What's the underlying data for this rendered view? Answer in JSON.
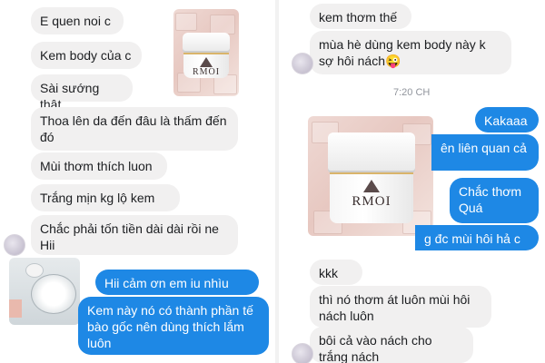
{
  "left_chat": {
    "incoming": [
      "E quen noi c",
      "Kem body của c",
      "Sài sướng thật",
      "Thoa lên da đến đâu là thấm đến đó",
      "Mùi thơm thích luon",
      "Trắng mịn kg lộ kem",
      "Chắc phải tốn tiền dài dài rồi ne Hii"
    ],
    "outgoing": [
      "Hii cảm ơn em iu nhìu nhé",
      "Kem này nó có thành phần tế bào gốc nên dùng thích lắm luôn"
    ],
    "photo_brand": "RMOI"
  },
  "right_chat": {
    "incoming_top": [
      "kem thơm thế",
      "mùa hè dùng kem body này k sợ hôi nách😜"
    ],
    "timestamp": "7:20 CH",
    "outgoing": [
      "Kakaaa",
      "ên liên quan cả",
      "Chắc thơm Quá",
      "g đc mùi hôi hả c"
    ],
    "incoming_bottom": [
      "kkk",
      "thì nó thơm át luôn mùi hôi nách luôn",
      "bôi cả vào nách cho trắng nách"
    ],
    "photo_brand": "RMOI"
  },
  "colors": {
    "outgoing_bubble": "#1e88e5",
    "incoming_bubble": "#f1f0f0",
    "background": "#ffffff"
  }
}
